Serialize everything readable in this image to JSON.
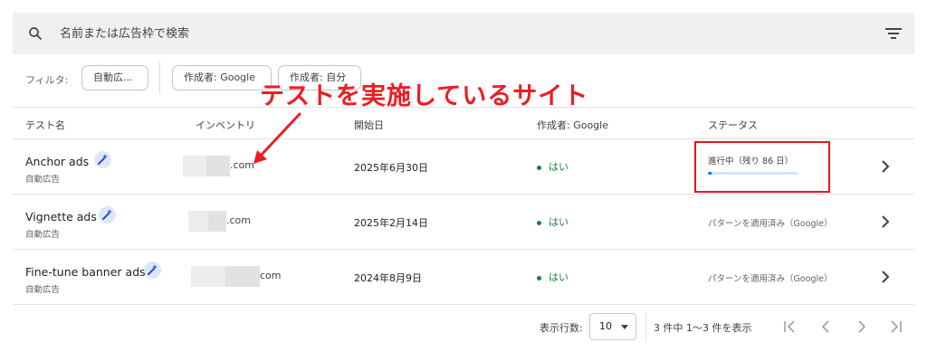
{
  "search": {
    "placeholder": "名前または広告枠で検索"
  },
  "filters": {
    "label": "フィルタ:",
    "chips": [
      "自動広...",
      "作成者: Google",
      "作成者: 自分"
    ]
  },
  "table": {
    "columns": [
      "テスト名",
      "インベントリ",
      "開始日",
      "作成者: Google",
      "ステータス"
    ],
    "rows": [
      {
        "name": "Anchor ads",
        "type": "自動広告",
        "inventory": ".com",
        "start_date": "2025年6月30日",
        "google": "はい",
        "status": "進行中（残り 86 日）",
        "progress": 0.04
      },
      {
        "name": "Vignette ads",
        "type": "自動広告",
        "inventory": ".com",
        "start_date": "2025年2月14日",
        "google": "はい",
        "status": "パターンを適用済み（Google）"
      },
      {
        "name": "Fine-tune banner ads",
        "type": "自動広告",
        "inventory": "com",
        "start_date": "2024年8月9日",
        "google": "はい",
        "status": "パターンを適用済み（Google）"
      }
    ]
  },
  "annotation": {
    "text": "テストを実施しているサイト",
    "color": "#ee1c24"
  },
  "pagination": {
    "rows_label": "表示行数:",
    "rows_value": "10",
    "count_text": "3 件中 1～3 件を表示"
  },
  "icons": [
    "search-icon",
    "filter-list-icon",
    "magic-wand-icon",
    "chevron-right-icon",
    "first-page-icon",
    "prev-page-icon",
    "next-page-icon",
    "last-page-icon"
  ],
  "colors": {
    "accent": "#1a73e8",
    "success": "#188038",
    "annotation_red": "#ee1c24",
    "search_bg": "#eff0f2"
  }
}
